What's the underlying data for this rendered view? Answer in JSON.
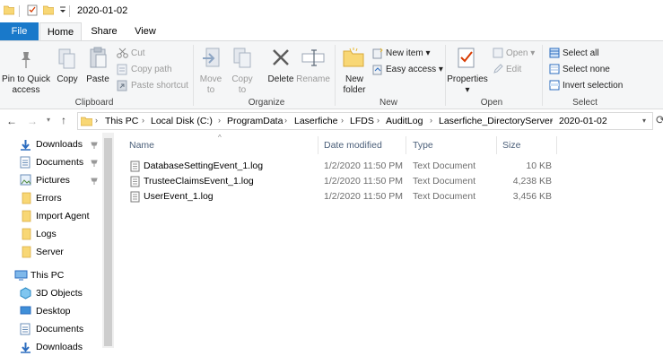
{
  "window": {
    "title": "2020-01-02"
  },
  "tabs": [
    {
      "label": "File"
    },
    {
      "label": "Home"
    },
    {
      "label": "Share"
    },
    {
      "label": "View"
    }
  ],
  "ribbon": {
    "clipboard": {
      "label": "Clipboard",
      "pin_line1": "Pin to Quick",
      "pin_line2": "access",
      "copy": "Copy",
      "paste": "Paste",
      "cut": "Cut",
      "copy_path": "Copy path",
      "paste_shortcut": "Paste shortcut"
    },
    "organize": {
      "label": "Organize",
      "move_line1": "Move",
      "move_line2": "to",
      "copy_line1": "Copy",
      "copy_line2": "to",
      "delete": "Delete",
      "rename": "Rename"
    },
    "new": {
      "label": "New",
      "folder_line1": "New",
      "folder_line2": "folder",
      "new_item": "New item",
      "easy_access": "Easy access"
    },
    "open": {
      "label": "Open",
      "properties": "Properties",
      "open": "Open",
      "edit": "Edit"
    },
    "select": {
      "label": "Select",
      "select_all": "Select all",
      "select_none": "Select none",
      "invert": "Invert selection"
    }
  },
  "address": {
    "crumbs": [
      "This PC",
      "Local Disk (C:)",
      "ProgramData",
      "Laserfiche",
      "LFDS",
      "AuditLog",
      "Laserfiche_DirectoryServer",
      "2020-01-02"
    ]
  },
  "nav": {
    "quick_access": [
      {
        "label": "Downloads",
        "icon": "download-icon",
        "pinned": true
      },
      {
        "label": "Documents",
        "icon": "document-icon",
        "pinned": true
      },
      {
        "label": "Pictures",
        "icon": "pictures-icon",
        "pinned": true
      },
      {
        "label": "Errors",
        "icon": "folder-icon",
        "pinned": false
      },
      {
        "label": "Import Agent",
        "icon": "folder-icon",
        "pinned": false
      },
      {
        "label": "Logs",
        "icon": "folder-icon",
        "pinned": false
      },
      {
        "label": "Server",
        "icon": "folder-icon",
        "pinned": false
      }
    ],
    "this_pc": "This PC",
    "pc_items": [
      {
        "label": "3D Objects",
        "icon": "3d-objects-icon"
      },
      {
        "label": "Desktop",
        "icon": "desktop-icon"
      },
      {
        "label": "Documents",
        "icon": "document-icon"
      },
      {
        "label": "Downloads",
        "icon": "download-icon"
      }
    ]
  },
  "columns": {
    "name": "Name",
    "date": "Date modified",
    "type": "Type",
    "size": "Size"
  },
  "files": [
    {
      "name": "DatabaseSettingEvent_1.log",
      "date": "1/2/2020 11:50 PM",
      "type": "Text Document",
      "size": "10 KB"
    },
    {
      "name": "TrusteeClaimsEvent_1.log",
      "date": "1/2/2020 11:50 PM",
      "type": "Text Document",
      "size": "4,238 KB"
    },
    {
      "name": "UserEvent_1.log",
      "date": "1/2/2020 11:50 PM",
      "type": "Text Document",
      "size": "3,456 KB"
    }
  ],
  "colors": {
    "file_tab": "#1979ca",
    "folder": "#f8d775",
    "accent": "#2b6cbf"
  }
}
